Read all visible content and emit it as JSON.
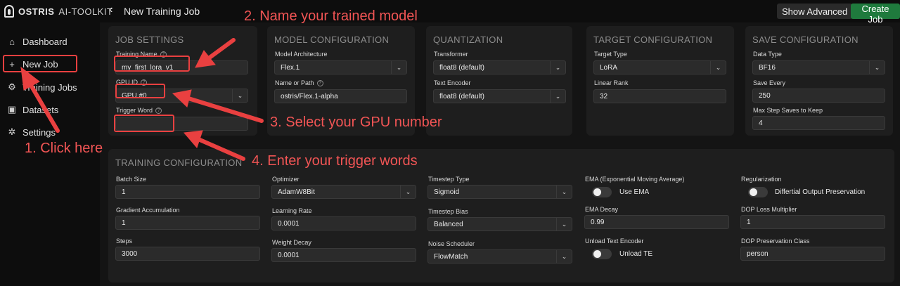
{
  "header": {
    "logo_text": "OSTRIS",
    "logo_sub": "AI-TOOLKIT",
    "back_icon": "chevron-left-icon",
    "page_title": "New Training Job",
    "show_advanced": "Show Advanced",
    "create_job": "Create Job"
  },
  "sidebar": {
    "items": [
      {
        "label": "Dashboard",
        "icon": "home-icon"
      },
      {
        "label": "New Job",
        "icon": "plus-icon"
      },
      {
        "label": "Training Jobs",
        "icon": "training-icon"
      },
      {
        "label": "Datasets",
        "icon": "image-icon"
      },
      {
        "label": "Settings",
        "icon": "gear-icon"
      }
    ]
  },
  "job_settings": {
    "title": "JOB SETTINGS",
    "training_name_label": "Training Name",
    "training_name_value": "my_first_lora_v1",
    "gpu_id_label": "GPU ID",
    "gpu_id_value": "GPU #0",
    "trigger_word_label": "Trigger Word",
    "trigger_word_value": ""
  },
  "model_configuration": {
    "title": "MODEL CONFIGURATION",
    "architecture_label": "Model Architecture",
    "architecture_value": "Flex.1",
    "name_or_path_label": "Name or Path",
    "name_or_path_value": "ostris/Flex.1-alpha"
  },
  "quantization": {
    "title": "QUANTIZATION",
    "transformer_label": "Transformer",
    "transformer_value": "float8 (default)",
    "text_encoder_label": "Text Encoder",
    "text_encoder_value": "float8 (default)"
  },
  "target_configuration": {
    "title": "TARGET CONFIGURATION",
    "target_type_label": "Target Type",
    "target_type_value": "LoRA",
    "linear_rank_label": "Linear Rank",
    "linear_rank_value": "32"
  },
  "save_configuration": {
    "title": "SAVE CONFIGURATION",
    "data_type_label": "Data Type",
    "data_type_value": "BF16",
    "save_every_label": "Save Every",
    "save_every_value": "250",
    "max_step_saves_label": "Max Step Saves to Keep",
    "max_step_saves_value": "4"
  },
  "training_configuration": {
    "title": "TRAINING CONFIGURATION",
    "batch_size_label": "Batch Size",
    "batch_size_value": "1",
    "grad_accum_label": "Gradient Accumulation",
    "grad_accum_value": "1",
    "steps_label": "Steps",
    "steps_value": "3000",
    "optimizer_label": "Optimizer",
    "optimizer_value": "AdamW8Bit",
    "learning_rate_label": "Learning Rate",
    "learning_rate_value": "0.0001",
    "weight_decay_label": "Weight Decay",
    "weight_decay_value": "0.0001",
    "timestep_type_label": "Timestep Type",
    "timestep_type_value": "Sigmoid",
    "timestep_bias_label": "Timestep Bias",
    "timestep_bias_value": "Balanced",
    "noise_scheduler_label": "Noise Scheduler",
    "noise_scheduler_value": "FlowMatch",
    "ema_label": "EMA (Exponential Moving Average)",
    "use_ema_label": "Use EMA",
    "ema_decay_label": "EMA Decay",
    "ema_decay_value": "0.99",
    "unload_te_section_label": "Unload Text Encoder",
    "unload_te_label": "Unload TE",
    "regularization_label": "Regularization",
    "dop_toggle_label": "Differtial Output Preservation",
    "dop_loss_label": "DOP Loss Multiplier",
    "dop_loss_value": "1",
    "dop_class_label": "DOP Preservation Class",
    "dop_class_value": "person"
  },
  "annotations": {
    "step1": "1. Click here",
    "step2": "2. Name your trained model",
    "step3": "3. Select your GPU number",
    "step4": "4. Enter your trigger words"
  },
  "colors": {
    "accent_green": "#1f7a3d",
    "annotation_red": "#e94040"
  }
}
